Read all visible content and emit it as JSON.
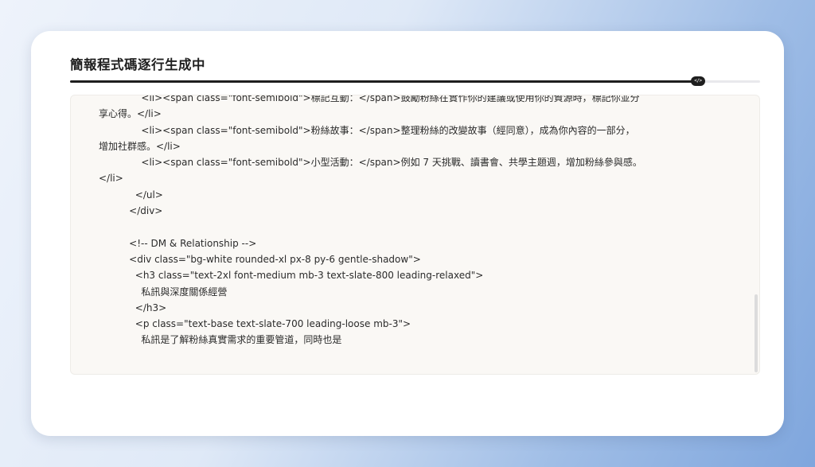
{
  "dialog": {
    "title": "簡報程式碼逐行生成中",
    "progress": 0.91,
    "thumb_icon": "code-icon",
    "thumb_glyph": "</>"
  },
  "code_lines": [
    "              <li><span class=\"font-semibold\">標記互動：</span>鼓勵粉絲在實作你的建議或使用你的資源時，標記你並分",
    "享心得。</li>",
    "              <li><span class=\"font-semibold\">粉絲故事：</span>整理粉絲的改變故事（經同意），成為你內容的一部分，",
    "增加社群感。</li>",
    "              <li><span class=\"font-semibold\">小型活動：</span>例如 7 天挑戰、讀書會、共學主題週，增加粉絲參與感。",
    "</li>",
    "            </ul>",
    "          </div>",
    "",
    "          <!-- DM & Relationship -->",
    "          <div class=\"bg-white rounded-xl px-8 py-6 gentle-shadow\">",
    "            <h3 class=\"text-2xl font-medium mb-3 text-slate-800 leading-relaxed\">",
    "              私訊與深度關係經營",
    "            </h3>",
    "            <p class=\"text-base text-slate-700 leading-loose mb-3\">",
    "              私訊是了解粉絲真實需求的重要管道，同時也是"
  ],
  "colors": {
    "accent": "#1e1e1e",
    "panel_bg": "#faf8f5"
  }
}
